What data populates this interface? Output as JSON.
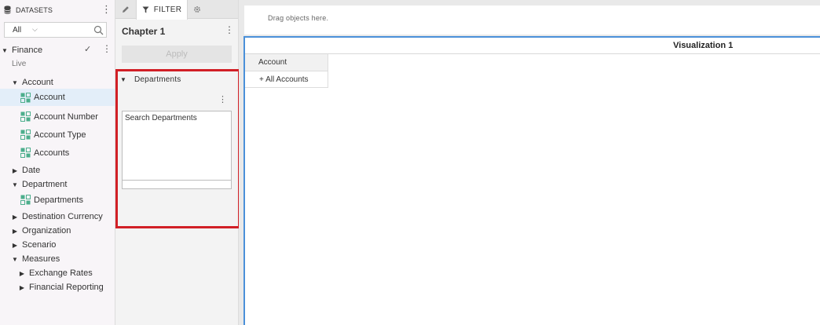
{
  "datasets": {
    "title": "DATASETS",
    "filter_value": "All",
    "tree": {
      "finance": "Finance",
      "finance_status": "Live",
      "account_group": "Account",
      "account": "Account",
      "account_number": "Account Number",
      "account_type": "Account Type",
      "accounts": "Accounts",
      "date": "Date",
      "department": "Department",
      "departments": "Departments",
      "destination_currency": "Destination Currency",
      "organization": "Organization",
      "scenario": "Scenario",
      "measures": "Measures",
      "exchange_rates": "Exchange Rates",
      "financial_reporting": "Financial Reporting"
    }
  },
  "filter_panel": {
    "tab_label": "FILTER",
    "chapter_title": "Chapter 1",
    "apply_label": "Apply",
    "departments_label": "Departments",
    "search_placeholder": "Search Departments"
  },
  "canvas": {
    "drop_hint": "Drag objects here.",
    "viz_title": "Visualization 1",
    "column_header": "Account",
    "row_value": "+ All Accounts"
  },
  "colors": {
    "highlight": "#d11f26",
    "selection": "#e3eef9",
    "viz_border": "#4a90d9",
    "field_icon": "#4cae8c"
  }
}
